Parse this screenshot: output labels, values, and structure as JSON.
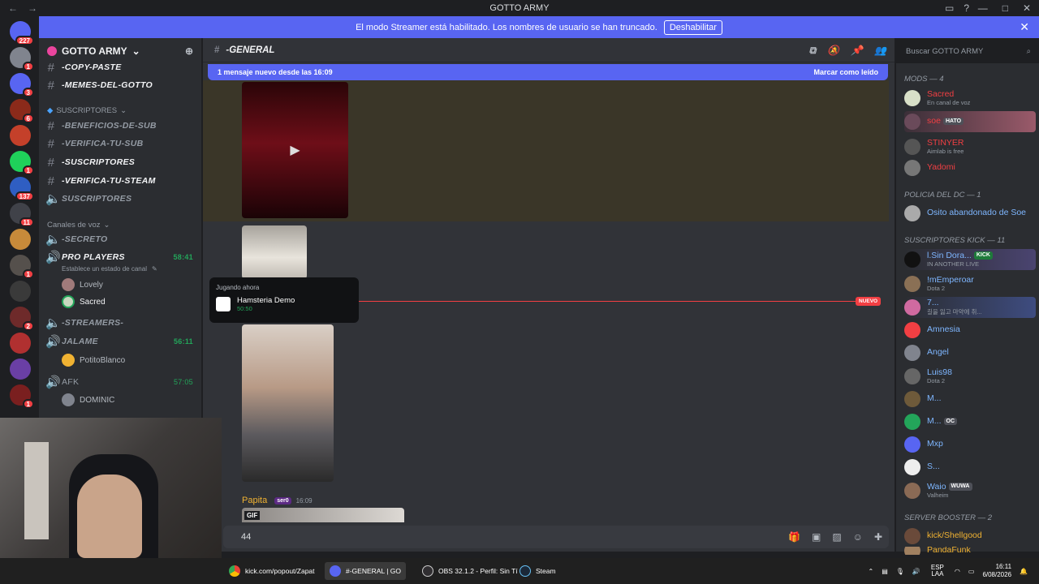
{
  "title": "GOTTO ARMY",
  "banner": {
    "text": "El modo Streamer está habilitado. Los nombres de usuario se han truncado.",
    "button": "Deshabilitar"
  },
  "guild_badges": {
    "home": "227",
    "b1": "1",
    "b2": "3",
    "b3": "6",
    "b4": "1",
    "b5": "137",
    "b6": "11",
    "b7": "1",
    "b8": "2",
    "b9": "1",
    "b10": "1"
  },
  "server": {
    "name": "GOTTO ARMY"
  },
  "channels": {
    "copy_paste": "-COPY-PASTE",
    "memes": "-MEMES-DEL-GOTTO",
    "cat_subs": "SUSCRIPTORES",
    "beneficios": "-BENEFICIOS-DE-SUB",
    "verifica_sub": "-VERIFICA-TU-SUB",
    "suscriptores": "-SUSCRIPTORES",
    "verifica_steam": "-VERIFICA-TU-STEAM",
    "suscriptores_voice": "SUSCRIPTORES",
    "cat_voice": "Canales de voz",
    "secreto": "-SECRETO",
    "pro_players": "PRO PLAYERS",
    "pro_timer": "58:41",
    "pro_status": "Establece un estado de canal",
    "lovely": "Lovely",
    "sacred": "Sacred",
    "streamers": "-STREAMERS-",
    "jalame": "JALAME",
    "jalame_timer": "56:11",
    "potito": "PotitoBlanco",
    "afk": "AFK",
    "afk_timer": "57:05",
    "dominic": "DOMINIC"
  },
  "main": {
    "channel": "-GENERAL",
    "new_msgs": "1 mensaje nuevo desde las 16:09",
    "mark_read": "Marcar como leído",
    "nuevo": "NUEVO",
    "author": "Papita",
    "author_tag": "ser0",
    "time": "16:09",
    "gif": "GIF",
    "composer_value": "44"
  },
  "popup": {
    "label": "Jugando ahora",
    "game": "Hamsteria Demo",
    "time": "50:50"
  },
  "search": {
    "placeholder": "Buscar GOTTO ARMY"
  },
  "members": {
    "cat_mods": "MODS — 4",
    "sacred": "Sacred",
    "sacred_sub": "En canal de voz",
    "soe": "soe",
    "soe_tag": "HATO",
    "stinyer": "STINYER",
    "stinyer_sub": "Aimlab is free",
    "yadomi": "Yadomi",
    "cat_police": "POLICIA DEL DC — 1",
    "osito": "Osito abandonado de Soe",
    "cat_kick": "SUSCRIPTORES KICK — 11",
    "sin_dora": "l.Sin Dora...",
    "sin_dora_tag": "KICK",
    "sin_dora_sub": "IN ANOTHER LIVE",
    "emperoar": "!mEmperoar",
    "emperoar_sub": "Dota 2",
    "seven": "7...",
    "seven_sub": "길을 잃고 마약에 취...",
    "amnesia": "Amnesia",
    "angel": "Angel",
    "luis": "Luis98",
    "luis_sub": "Dota 2",
    "m1": "M...",
    "m2": "M...",
    "m2_tag": "OC",
    "mxp": "Mxp",
    "s": "S...",
    "waio": "Waio",
    "waio_tag": "WUWA",
    "waio_sub": "Valheim",
    "cat_boost": "SERVER BOOSTER — 2",
    "shellgood": "kick/Shellgood",
    "pandafunk": "PandaFunk"
  },
  "taskbar": {
    "chrome": "kick.com/popout/Zapat",
    "discord": "#-GENERAL | GO",
    "obs": "OBS 32.1.2 - Perfil: Sin Tí",
    "steam": "Steam",
    "lang": "ESP LAA",
    "time": "16:11",
    "date": "6/08/2026"
  }
}
